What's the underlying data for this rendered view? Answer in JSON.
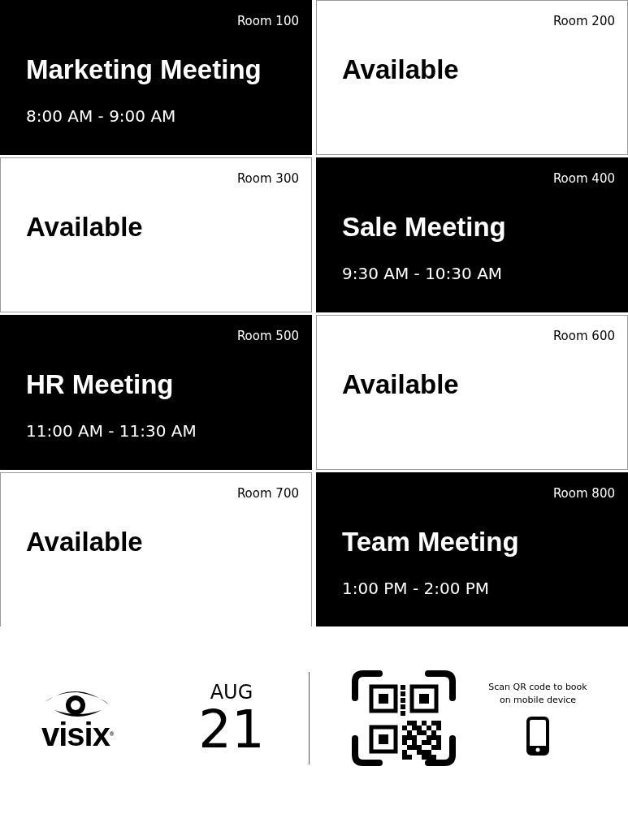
{
  "rooms": [
    {
      "room": "Room 100",
      "kind": "booked",
      "title": "Marketing Meeting",
      "time": "8:00 AM - 9:00 AM"
    },
    {
      "room": "Room 200",
      "kind": "available",
      "title": "Available"
    },
    {
      "room": "Room 300",
      "kind": "available",
      "title": "Available"
    },
    {
      "room": "Room 400",
      "kind": "booked",
      "title": "Sale Meeting",
      "time": "9:30 AM - 10:30 AM"
    },
    {
      "room": "Room 500",
      "kind": "booked",
      "title": "HR Meeting",
      "time": "11:00 AM - 11:30 AM"
    },
    {
      "room": "Room 600",
      "kind": "available",
      "title": "Available"
    },
    {
      "room": "Room 700",
      "kind": "available",
      "title": "Available"
    },
    {
      "room": "Room 800",
      "kind": "booked",
      "title": "Team Meeting",
      "time": "1:00 PM - 2:00 PM"
    }
  ],
  "footer": {
    "logo": "visix",
    "logo_mark": "®",
    "month": "AUG",
    "day": "21",
    "qr_caption": "Scan QR code to book on mobile device"
  }
}
